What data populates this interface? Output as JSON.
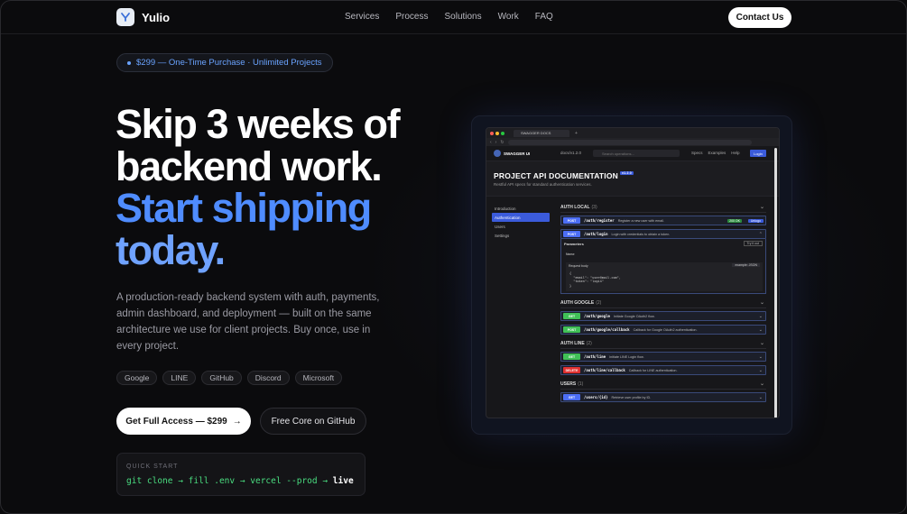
{
  "nav": {
    "brand": "Yulio",
    "links": [
      "Services",
      "Process",
      "Solutions",
      "Work",
      "FAQ"
    ],
    "contact": "Contact Us"
  },
  "hero": {
    "badge": "$299 — One-Time Purchase · Unlimited Projects",
    "headline_white_1": "Skip 3 weeks of",
    "headline_white_2": "backend work.",
    "headline_blue_1": "Start shipping",
    "headline_blue_2": "today.",
    "description": "A production-ready backend system with auth, payments, admin dashboard, and deployment — built on the same architecture we use for client projects. Buy once, use in every project.",
    "tags": [
      "Google",
      "LINE",
      "GitHub",
      "Discord",
      "Microsoft"
    ],
    "primary_cta": "Get Full Access — $299",
    "primary_arrow": "→",
    "secondary_cta": "Free Core on GitHub",
    "quickstart_label": "QUICK START",
    "quickstart_code": "git clone → fill .env → vercel --prod → ",
    "quickstart_live": "live"
  },
  "mock": {
    "tab": "SWAGGER DOCS",
    "brand": "SWAGGER UI",
    "version_path": "docs/v1.2.0",
    "search_placeholder": "Search operations...",
    "nav": [
      "Specs",
      "Examples",
      "Help"
    ],
    "login": "Login",
    "title": "PROJECT API DOCUMENTATION",
    "title_version": "v1.2.0",
    "subtitle": "Restful API specs for standard authentication services.",
    "sidebar": [
      "Introduction",
      "Authentication",
      "Users",
      "Settings"
    ],
    "groups": {
      "local": {
        "name": "AUTH LOCAL",
        "count": "(3)"
      },
      "google": {
        "name": "AUTH GOOGLE",
        "count": "(2)"
      },
      "line": {
        "name": "AUTH LINE",
        "count": "(2)"
      },
      "users": {
        "name": "USERS",
        "count": "(1)"
      }
    },
    "endpoints": {
      "register": {
        "method": "POST",
        "path": "/auth/register",
        "desc": "Register a new user with email.",
        "status": "200 OK",
        "auth": "Unlogo"
      },
      "login": {
        "method": "POST",
        "path": "/auth/login",
        "desc": "Login with credentials to obtain a token."
      },
      "google": {
        "method": "GET",
        "path": "/auth/google",
        "desc": "Initiate Google OAuth2 flow."
      },
      "google_cb": {
        "method": "POST",
        "path": "/auth/google/callback",
        "desc": "Callback for Google OAuth2 authentication."
      },
      "line": {
        "method": "GET",
        "path": "/auth/line",
        "desc": "Initiate LINE Login flow."
      },
      "line_cb": {
        "method": "DELETE",
        "path": "/auth/line/callback",
        "desc": "Callback for LINE authentication."
      },
      "user": {
        "method": "GET",
        "path": "/users/{id}",
        "desc": "Retrieve user profile by ID."
      }
    },
    "params_label": "Parameters",
    "try_label": "Try it out",
    "name_label": "Name",
    "request_body": "Request body",
    "example_select": "example: JSON",
    "body_code": "{\n  \"email\": \"user@mail.com\",\n  \"token\": \"login\"\n}"
  }
}
